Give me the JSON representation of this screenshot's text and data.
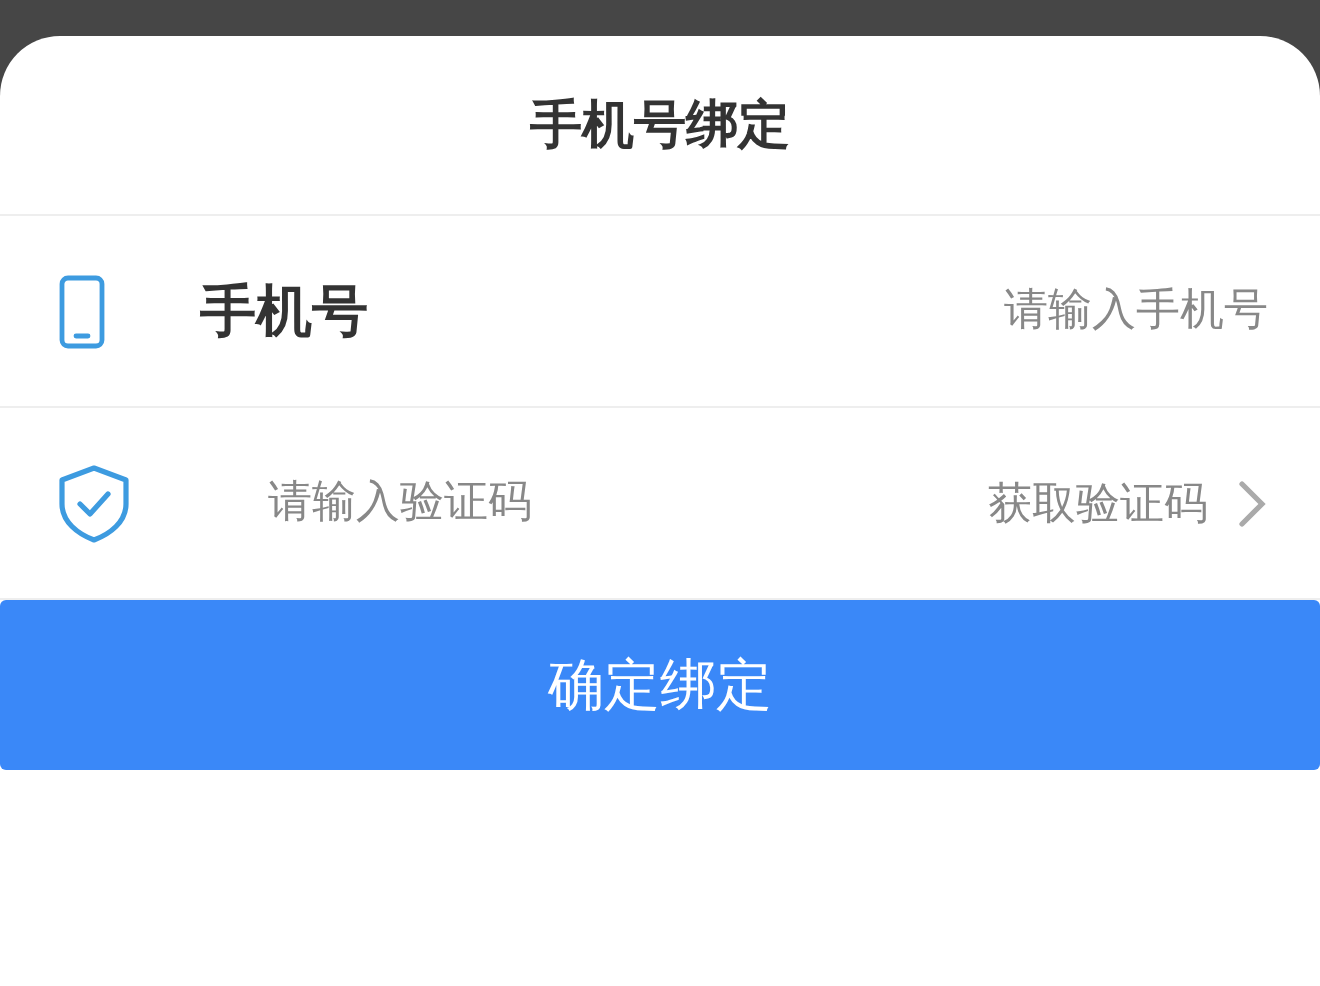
{
  "sheet": {
    "title": "手机号绑定"
  },
  "phone_row": {
    "label": "手机号",
    "placeholder": "请输入手机号"
  },
  "code_row": {
    "placeholder": "请输入验证码",
    "action": "获取验证码"
  },
  "submit_button": {
    "label": "确定绑定"
  }
}
